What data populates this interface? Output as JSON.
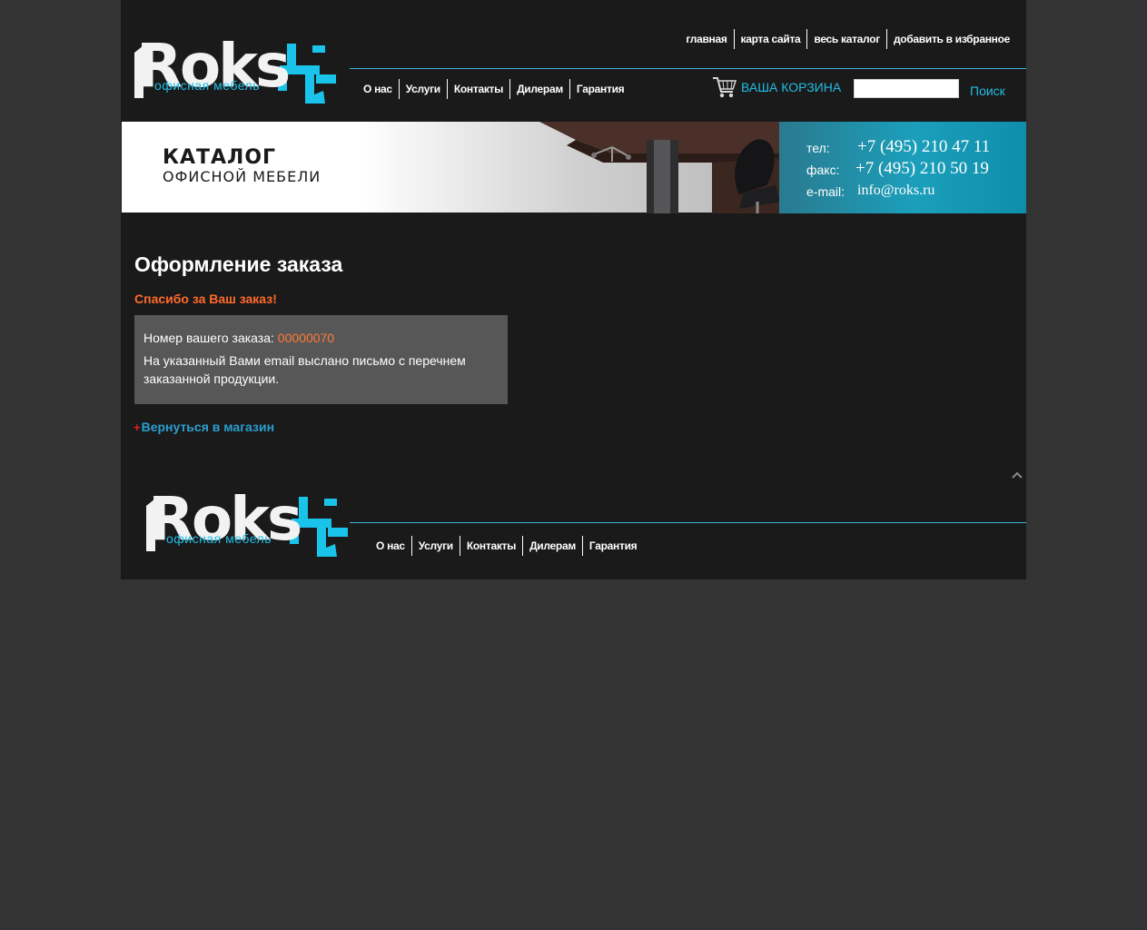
{
  "header": {
    "logo": {
      "word": "Roks",
      "tagline": "офисная мебель"
    },
    "top_links": [
      "главная",
      "карта сайта",
      "весь каталог",
      "добавить в избранное"
    ],
    "nav": [
      "О нас",
      "Услуги",
      "Контакты",
      "Дилерам",
      "Гарантия"
    ],
    "cart_label": "ВАША КОРЗИНА",
    "search": {
      "value": "",
      "button": "Поиск"
    }
  },
  "banner": {
    "title_line1": "КАТАЛОГ",
    "title_line2": "ОФИСНОЙ МЕБЕЛИ",
    "phone_label": "тел:",
    "phone": "+7 (495) 210 47 11",
    "fax_label": "факс:",
    "fax": "+7 (495) 210 50 19",
    "email_label": "e-mail:",
    "email": "info@roks.ru"
  },
  "content": {
    "heading": "Оформление заказа",
    "thanks": "Спасибо за Ваш заказ!",
    "order_label": "Номер вашего заказа:",
    "order_number": "00000070",
    "message": "На указанный Вами email выслано письмо с перечнем заказанной продукции.",
    "back_plus": "+",
    "back_link": "Вернуться в магазин"
  },
  "footer": {
    "logo": {
      "word": "Roks",
      "tagline": "офисная мебель"
    },
    "nav": [
      "О нас",
      "Услуги",
      "Контакты",
      "Дилерам",
      "Гарантия"
    ]
  },
  "colors": {
    "page_bg": "#333333",
    "panel_bg": "#1a1a1b",
    "accent": "#22bde3",
    "orange": "#ff6a2a",
    "box_bg": "#575757"
  },
  "icons": [
    "shopping-cart-icon",
    "roks-logo-mark",
    "scroll-to-top-icon"
  ]
}
